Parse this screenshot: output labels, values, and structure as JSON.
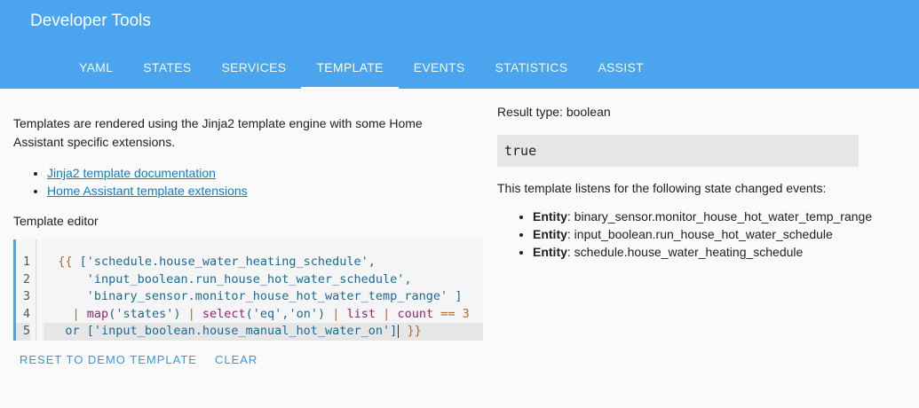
{
  "app": {
    "title": "Developer Tools"
  },
  "tabs": [
    {
      "label": "YAML"
    },
    {
      "label": "STATES"
    },
    {
      "label": "SERVICES"
    },
    {
      "label": "TEMPLATE",
      "active": true
    },
    {
      "label": "EVENTS"
    },
    {
      "label": "STATISTICS"
    },
    {
      "label": "ASSIST"
    }
  ],
  "left": {
    "intro": "Templates are rendered using the Jinja2 template engine with some Home Assistant specific extensions.",
    "links": [
      {
        "label": "Jinja2 template documentation"
      },
      {
        "label": "Home Assistant template extensions"
      }
    ],
    "editor_label": "Template editor",
    "line_numbers": [
      "1",
      "2",
      "3",
      "4",
      "5"
    ],
    "code": {
      "l1_open": "{{",
      "l1_str": "['schedule.house_water_heating_schedule',",
      "l2_str": "'input_boolean.run_house_hot_water_schedule',",
      "l3_str": "'binary_sensor.monitor_house_hot_water_temp_range'",
      "l3_close": "]",
      "l4_pipe1": "|",
      "l4_f1": "map",
      "l4_a1": "('states')",
      "l4_pipe2": "|",
      "l4_f2": "select",
      "l4_a2": "('eq','on')",
      "l4_pipe3": "|",
      "l4_f3": "list",
      "l4_pipe4": "|",
      "l4_f4": "count",
      "l4_op": "== 3",
      "l5_or": "or",
      "l5_str": "['input_boolean.house_manual_hot_water_on']",
      "l5_close": "}}"
    },
    "buttons": {
      "reset": "RESET TO DEMO TEMPLATE",
      "clear": "CLEAR"
    }
  },
  "right": {
    "result_type": "Result type: boolean",
    "result_value": "true",
    "listens_text": "This template listens for the following state changed events:",
    "entity_label": "Entity",
    "entities": [
      "binary_sensor.monitor_house_hot_water_temp_range",
      "input_boolean.run_house_hot_water_schedule",
      "schedule.house_water_heating_schedule"
    ]
  },
  "colors": {
    "header": "#4aa4ee",
    "link": "#0b7fc4",
    "button": "#3a97d9"
  }
}
